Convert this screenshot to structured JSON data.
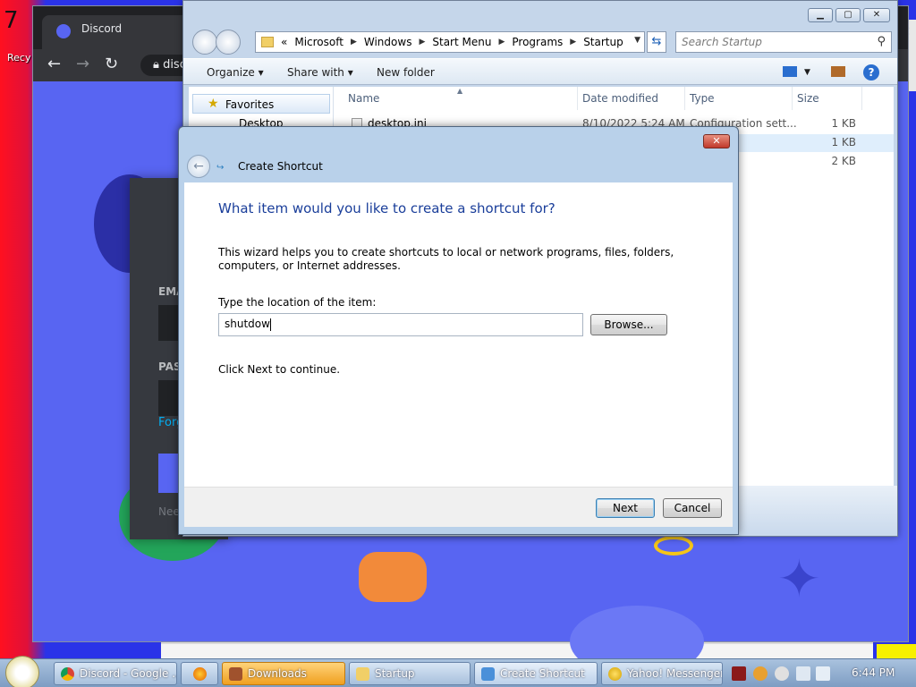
{
  "desktop": {
    "corner_number": "7",
    "recycle_label": "Recy"
  },
  "browser": {
    "tab_title": "Discord",
    "address_text": "disco",
    "discord": {
      "email_label": "EMA",
      "password_label": "PAS",
      "forgot_link": "Forg",
      "need_text": "Nee"
    }
  },
  "explorer": {
    "breadcrumb": [
      "«",
      "Microsoft",
      "Windows",
      "Start Menu",
      "Programs",
      "Startup"
    ],
    "search_placeholder": "Search Startup",
    "toolbar": {
      "organize": "Organize",
      "share_with": "Share with",
      "new_folder": "New folder"
    },
    "favorites_label": "Favorites",
    "desktop_label": "Desktop",
    "columns": {
      "name": "Name",
      "date": "Date modified",
      "type": "Type",
      "size": "Size"
    },
    "files": [
      {
        "name": "desktop.ini",
        "date": "8/10/2022 5:24 AM",
        "type": "Configuration sett...",
        "size": "1 KB"
      },
      {
        "name": "",
        "date": "",
        "type": "",
        "size": "1 KB"
      },
      {
        "name": "",
        "date": "",
        "type": "",
        "size": "2 KB"
      }
    ]
  },
  "wizard": {
    "title": "Create Shortcut",
    "close_glyph": "✕",
    "heading": "What item would you like to create a shortcut for?",
    "description": "This wizard helps you to create shortcuts to local or network programs, files, folders, computers, or Internet addresses.",
    "location_label": "Type the location of the item:",
    "location_value": "shutdow",
    "browse_label": "Browse...",
    "continue_text": "Click Next to continue.",
    "next_label": "Next",
    "cancel_label": "Cancel"
  },
  "taskbar": {
    "items": [
      {
        "label": "Discord - Google ..."
      },
      {
        "label": ""
      },
      {
        "label": "Downloads"
      },
      {
        "label": "Startup"
      },
      {
        "label": "Create Shortcut"
      },
      {
        "label": "Yahoo! Messenger"
      }
    ],
    "clock": "6:44 PM"
  },
  "colors": {
    "discord_blurple": "#5865f2",
    "wizard_heading": "#1a3e9a",
    "taskbar_orange": "#f0a020"
  }
}
